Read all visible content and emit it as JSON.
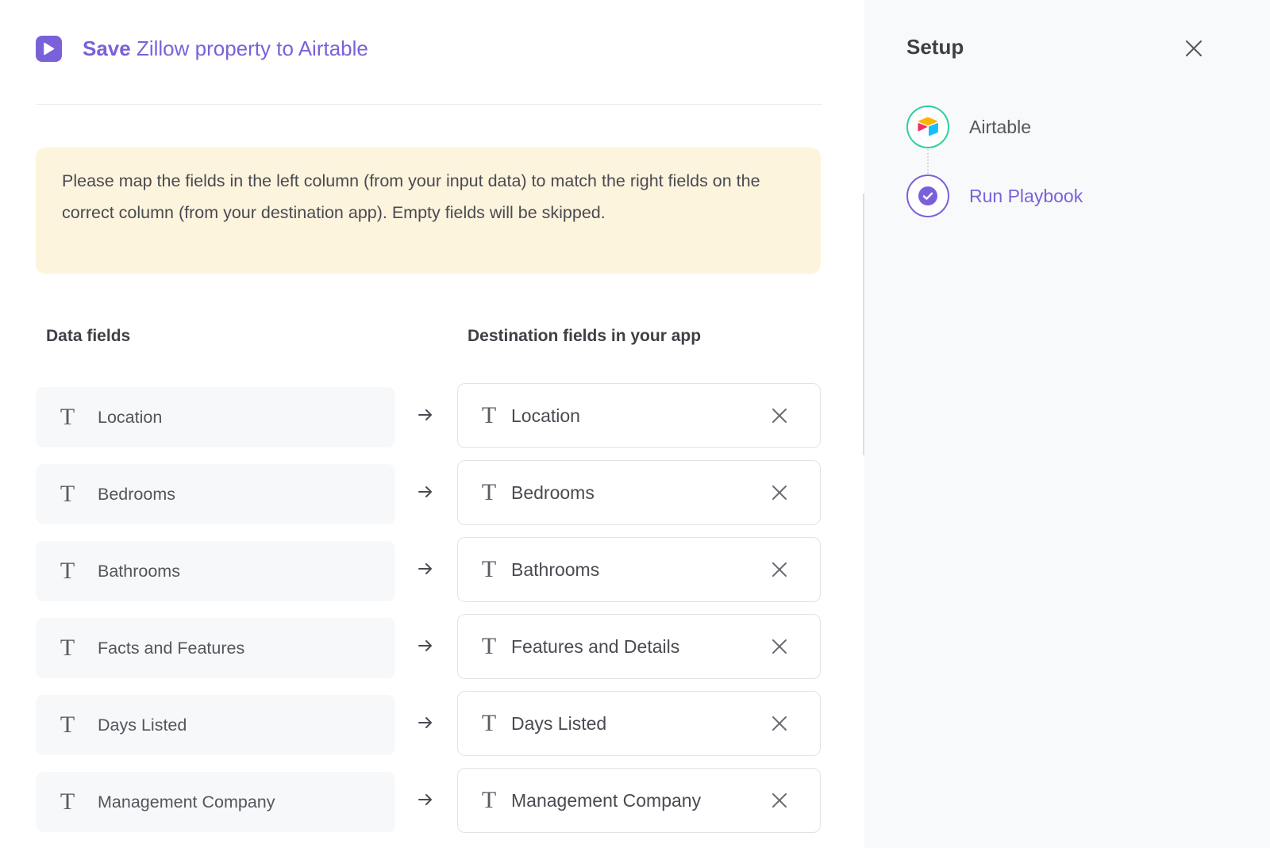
{
  "header": {
    "title_strong": "Save",
    "title_rest": "Zillow property to Airtable"
  },
  "notice": {
    "text": "Please map the fields in the left column (from your input data) to match the right fields on the correct column (from your destination app). Empty fields will be skipped."
  },
  "columns": {
    "left": "Data fields",
    "right": "Destination fields in your app"
  },
  "mappings": [
    {
      "source": "Location",
      "destination": "Location"
    },
    {
      "source": "Bedrooms",
      "destination": "Bedrooms"
    },
    {
      "source": "Bathrooms",
      "destination": "Bathrooms"
    },
    {
      "source": "Facts and Features",
      "destination": "Features and Details"
    },
    {
      "source": "Days Listed",
      "destination": "Days Listed"
    },
    {
      "source": "Management Company",
      "destination": "Management Company"
    }
  ],
  "field_type_glyph": "T",
  "setup": {
    "title": "Setup",
    "steps": [
      {
        "label": "Airtable",
        "icon": "airtable-logo-icon",
        "status": "done"
      },
      {
        "label": "Run Playbook",
        "icon": "check-circle-icon",
        "status": "active"
      }
    ]
  },
  "colors": {
    "accent": "#7b61d9",
    "notice_bg": "#fcf4dd",
    "success": "#2fcf9b",
    "panel_bg": "#f8f9fa"
  }
}
